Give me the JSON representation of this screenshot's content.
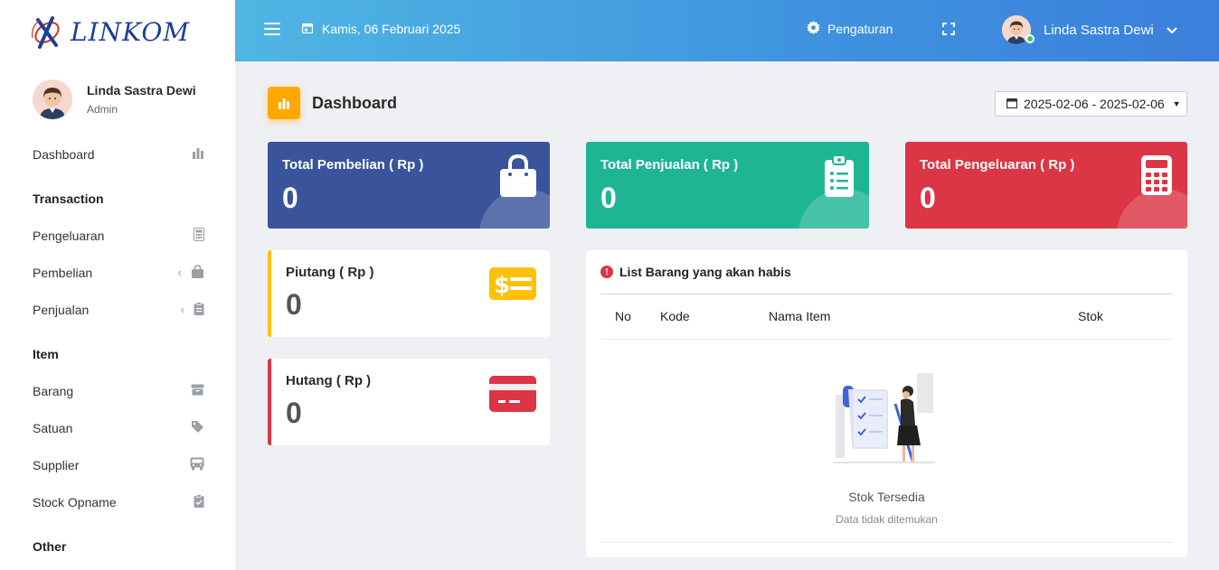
{
  "brand": {
    "name": "LINKOM"
  },
  "profile": {
    "name": "Linda Sastra Dewi",
    "role": "Admin"
  },
  "sidebar": {
    "items": [
      {
        "type": "item",
        "label": "Dashboard",
        "icon": "bar-chart-icon"
      },
      {
        "type": "section",
        "label": "Transaction"
      },
      {
        "type": "item",
        "label": "Pengeluaran",
        "icon": "calculator-icon"
      },
      {
        "type": "item",
        "label": "Pembelian",
        "icon": "shopping-bag-icon",
        "submenu": true
      },
      {
        "type": "item",
        "label": "Penjualan",
        "icon": "clipboard-icon",
        "submenu": true
      },
      {
        "type": "section",
        "label": "Item"
      },
      {
        "type": "item",
        "label": "Barang",
        "icon": "box-icon"
      },
      {
        "type": "item",
        "label": "Satuan",
        "icon": "tag-icon"
      },
      {
        "type": "item",
        "label": "Supplier",
        "icon": "truck-icon"
      },
      {
        "type": "item",
        "label": "Stock Opname",
        "icon": "clipboard-check-icon"
      },
      {
        "type": "section",
        "label": "Other"
      }
    ]
  },
  "header": {
    "date": "Kamis, 06 Februari 2025",
    "settings_label": "Pengaturan",
    "user_name": "Linda Sastra Dewi"
  },
  "page": {
    "title": "Dashboard",
    "date_range": "2025-02-06 - 2025-02-06"
  },
  "summary_cards": [
    {
      "label": "Total Pembelian ( Rp )",
      "value": "0",
      "color": "#3a549c",
      "icon": "shopping-bag-icon"
    },
    {
      "label": "Total Penjualan ( Rp )",
      "value": "0",
      "color": "#1eb595",
      "icon": "clipboard-list-icon"
    },
    {
      "label": "Total Pengeluaran ( Rp )",
      "value": "0",
      "color": "#dc3545",
      "icon": "calculator-icon"
    }
  ],
  "debt_cards": [
    {
      "label": "Piutang ( Rp )",
      "value": "0",
      "color": "#ffc107",
      "icon": "money-icon"
    },
    {
      "label": "Hutang ( Rp )",
      "value": "0",
      "color": "#dc3545",
      "icon": "credit-card-icon"
    }
  ],
  "stock_table": {
    "title": "List Barang yang akan habis",
    "columns": [
      "No",
      "Kode",
      "Nama Item",
      "Stok"
    ],
    "empty_title": "Stok Tersedia",
    "empty_subtitle": "Data tidak ditemukan"
  }
}
